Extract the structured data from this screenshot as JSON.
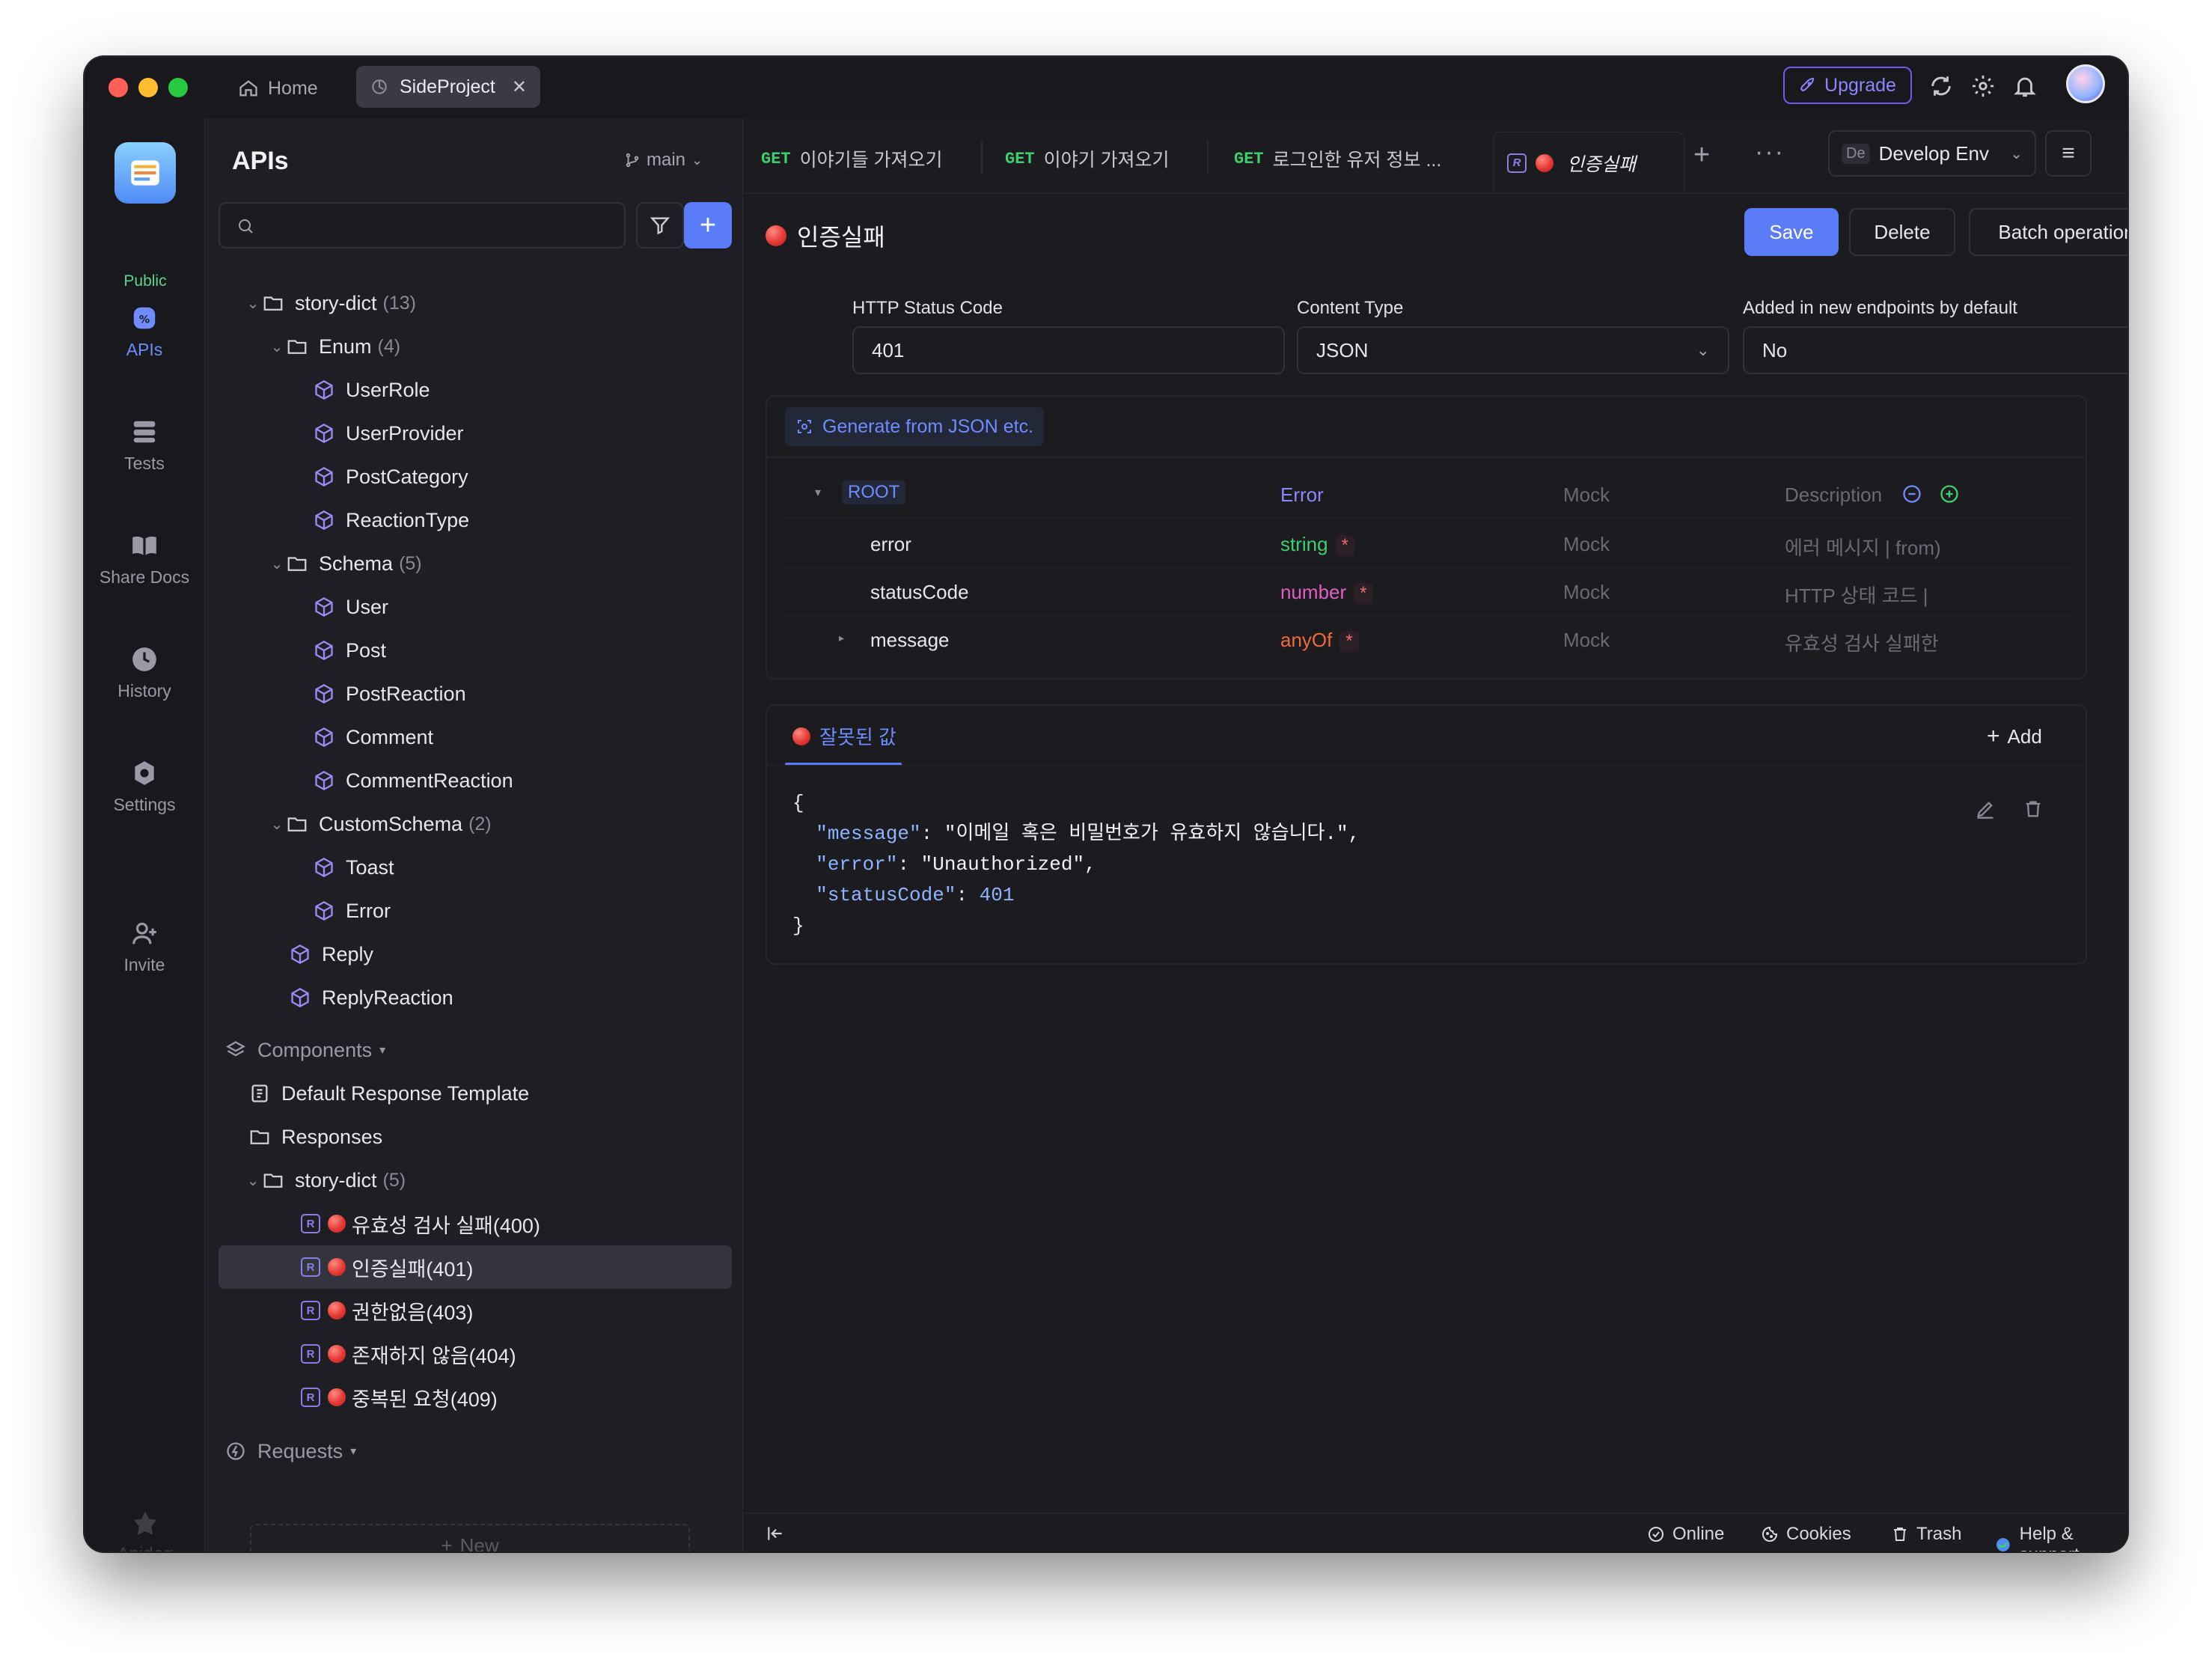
{
  "titlebar": {
    "home_label": "Home",
    "project_tab": "SideProject",
    "upgrade_label": "Upgrade"
  },
  "rail": {
    "public_label": "Public",
    "items": [
      {
        "label": "APIs",
        "icon": "apis-icon",
        "active": true
      },
      {
        "label": "Tests",
        "icon": "tests-icon"
      },
      {
        "label": "Share Docs",
        "icon": "book-icon"
      },
      {
        "label": "History",
        "icon": "clock-icon"
      },
      {
        "label": "Settings",
        "icon": "gear-icon"
      },
      {
        "label": "Invite",
        "icon": "invite-icon"
      }
    ],
    "brand": "Apidog"
  },
  "sidebar": {
    "title": "APIs",
    "branch": "main",
    "search_placeholder": "",
    "tree": [
      {
        "label": "story-dict",
        "count": "(13)",
        "kind": "folder"
      },
      {
        "label": "Enum",
        "count": "(4)",
        "kind": "folder"
      },
      {
        "label": "UserRole",
        "kind": "schema"
      },
      {
        "label": "UserProvider",
        "kind": "schema"
      },
      {
        "label": "PostCategory",
        "kind": "schema"
      },
      {
        "label": "ReactionType",
        "kind": "schema"
      },
      {
        "label": "Schema",
        "count": "(5)",
        "kind": "folder"
      },
      {
        "label": "User",
        "kind": "schema"
      },
      {
        "label": "Post",
        "kind": "schema"
      },
      {
        "label": "PostReaction",
        "kind": "schema"
      },
      {
        "label": "Comment",
        "kind": "schema"
      },
      {
        "label": "CommentReaction",
        "kind": "schema"
      },
      {
        "label": "CustomSchema",
        "count": "(2)",
        "kind": "folder"
      },
      {
        "label": "Toast",
        "kind": "schema"
      },
      {
        "label": "Error",
        "kind": "schema"
      },
      {
        "label": "Reply",
        "kind": "schema"
      },
      {
        "label": "ReplyReaction",
        "kind": "schema"
      }
    ],
    "components_label": "Components",
    "default_template": "Default Response Template",
    "responses_label": "Responses",
    "resp_folder": {
      "label": "story-dict",
      "count": "(5)"
    },
    "responses": [
      {
        "label": "유효성 검사 실패(400)"
      },
      {
        "label": "인증실패(401)",
        "selected": true
      },
      {
        "label": "권한없음(403)"
      },
      {
        "label": "존재하지 않음(404)"
      },
      {
        "label": "중복된 요청(409)"
      }
    ],
    "requests_label": "Requests",
    "new_label": "New"
  },
  "tabs": [
    {
      "method": "GET",
      "label": "이야기들 가져오기"
    },
    {
      "method": "GET",
      "label": "이야기 가져오기"
    },
    {
      "method": "GET",
      "label": "로그인한 유저 정보 ..."
    }
  ],
  "active_tab": "인증실패",
  "env": {
    "badge": "De",
    "label": "Develop Env"
  },
  "response": {
    "title": "인증실패",
    "save": "Save",
    "delete": "Delete",
    "batch": "Batch operations",
    "status_label": "HTTP Status Code",
    "status_value": "401",
    "content_label": "Content Type",
    "content_value": "JSON",
    "default_label": "Added in new endpoints by default",
    "default_value": "No",
    "generate_label": "Generate from JSON etc."
  },
  "schema": {
    "root": {
      "name": "ROOT",
      "type": "Error",
      "mock": "Mock",
      "desc": "Description"
    },
    "rows": [
      {
        "name": "error",
        "type": "string",
        "mock": "Mock",
        "desc": "에러 메시지 | from)"
      },
      {
        "name": "statusCode",
        "type": "number",
        "mock": "Mock",
        "desc": "HTTP 상태 코드 |"
      },
      {
        "name": "message",
        "type": "anyOf",
        "mock": "Mock",
        "desc": "유효성 검사 실패한"
      }
    ],
    "required_mark": "*"
  },
  "example": {
    "tab_label": "잘못된 값",
    "add_label": "Add",
    "open_brace": "{",
    "close_brace": "}",
    "lines": [
      {
        "key": "\"message\"",
        "value": "\"이메일 혹은 비밀번호가 유효하지 않습니다.\","
      },
      {
        "key": "\"error\"",
        "value": "\"Unauthorized\","
      },
      {
        "key": "\"statusCode\"",
        "value": "401"
      }
    ]
  },
  "status": {
    "online": "Online",
    "cookies": "Cookies",
    "trash": "Trash",
    "help": "Help & support"
  },
  "colors": {
    "accent": "#5b7cf7",
    "get": "#3ecf6e",
    "string_type": "#3ecf6e",
    "number_type": "#e05fc4",
    "anyof_type": "#f06a3a"
  }
}
